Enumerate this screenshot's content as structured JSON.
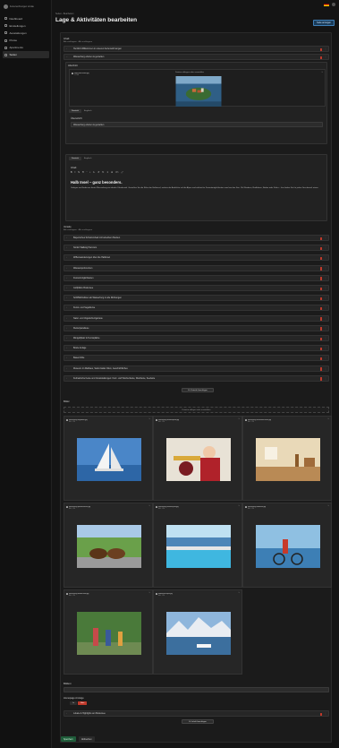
{
  "app": {
    "logo_text": "Ferienwohnungen Lindau"
  },
  "sidebar": {
    "items": [
      {
        "label": "Dashboard",
        "icon": "home-icon"
      },
      {
        "label": "Einstellungen",
        "icon": "settings-icon"
      },
      {
        "label": "Ausstattungen",
        "icon": "list-icon"
      },
      {
        "label": "Preise",
        "icon": "tag-icon"
      },
      {
        "label": "Apartments",
        "icon": "building-icon"
      },
      {
        "label": "Seiten",
        "icon": "page-icon"
      }
    ]
  },
  "header": {
    "breadcrumb": "Seiten  ›  Bearbeiten",
    "title": "Lage & Aktivitäten bearbeiten",
    "save_label": "Seite anzeigen"
  },
  "intro": {
    "label": "Inhalt",
    "sub": "Alle einklappen  ·  Alle ausklappen",
    "rows": [
      "Herzlich Willkommen in unseren Ferienwohnungen",
      "Wasserburg erleben & genießen"
    ]
  },
  "hero": {
    "label": "Abschnitt",
    "image_title": "hotel-insel-lindau.jpg",
    "image_meta": "1.2 MB",
    "upload_hint": "Dateien ablegen oder auswählen",
    "tabs": [
      "Deutsch",
      "Englisch"
    ],
    "field_label": "Überschrift",
    "field_value": "Wasserburg erleben & genießen"
  },
  "text": {
    "tabs": [
      "Deutsch",
      "Englisch"
    ],
    "field_label": "Inhalt",
    "toolbar": [
      "B",
      "I",
      "S",
      "H",
      "“",
      "•",
      "1.",
      "↺",
      "↻",
      "⚭",
      "⧉",
      "</>",
      "⤢"
    ],
    "heading": "Halb Insel – ganz besonders.",
    "paragraph": "Gelegen am Bodensee bietet Wasserburg ein ideales Urlaubsziel. Genießen Sie die Ruhe der Halbinsel, malerische Ausblicke auf die Alpen und zahlreiche Freizeitmöglichkeiten rund um den See. Ob Wandern, Radfahren, Baden oder Kultur – hier finden Sie für jeden Geschmack etwas."
  },
  "activities": {
    "label": "Vorteile",
    "sub": "Alle einklappen  ·  Alle ausklappen",
    "items": [
      "Bayerisches Schwimmbad mit beheiztem Becken",
      "Nordic Walking Parcours",
      "Wiffenwanderungen über die Halbinsel",
      "Wassersportzentren",
      "Freizeitmöglichkeiten",
      "Golfplätze Bodensee",
      "Schifffahrtslinien ab Wasserburg in alle Richtungen",
      "Kunst- und Segelkurse",
      "Natur- und Vogelschutzgebiete",
      "Kletterparadiese",
      "Minigolfplatz & Tennisplätze",
      "Boule-Anlage",
      "Bauernhöfe",
      "Museum im Malhaus, Sankt Galler Wein, Geschichtliches",
      "Kulinarische Feste und Veranstaltungen: Kurz- und Wochenfeste, Weinfeste, Seefeste"
    ],
    "add_label": "Zu Vorteile hinzufügen"
  },
  "gallery": {
    "label": "Bilder",
    "upload_hint": "Dateien ablegen oder auswählen",
    "images": [
      {
        "title": "wasserburg-segelboot.jpg",
        "meta": "Bild · JPG",
        "scene": "sailboat"
      },
      {
        "title": "wasserburg-musikkapelle.jpg",
        "meta": "Bild · JPG",
        "scene": "band"
      },
      {
        "title": "wasserburg-restaurant-innen.jpg",
        "meta": "Bild · JPG",
        "scene": "interior"
      },
      {
        "title": "wasserburg-pferdekutsche.jpg",
        "meta": "Bild · JPG",
        "scene": "horses"
      },
      {
        "title": "wasserburg-seebad-pool.jpg",
        "meta": "Bild · JPG",
        "scene": "pool"
      },
      {
        "title": "wasserburg-radfahrer.jpg",
        "meta": "Bild · JPG",
        "scene": "bikes"
      },
      {
        "title": "wasserburg-familie-wald.jpg",
        "meta": "Bild · JPG",
        "scene": "family"
      },
      {
        "title": "bodensee-alpen.jpg",
        "meta": "Bild · JPG",
        "scene": "lake"
      }
    ]
  },
  "footer_section": {
    "label": "Bildtext",
    "show_label": "Homepage Anzeige",
    "toggle": [
      "Ja",
      "Nein"
    ],
    "row": "Lokale & Highlights am Bodensee",
    "add_label": "Zu Inhalt hinzufügen"
  },
  "actions": {
    "save": "Speichern",
    "cancel": "Abbrechen"
  },
  "colors": {
    "accent": "#3f7fb6",
    "danger": "#c0392b",
    "success": "#1f5c3a"
  }
}
